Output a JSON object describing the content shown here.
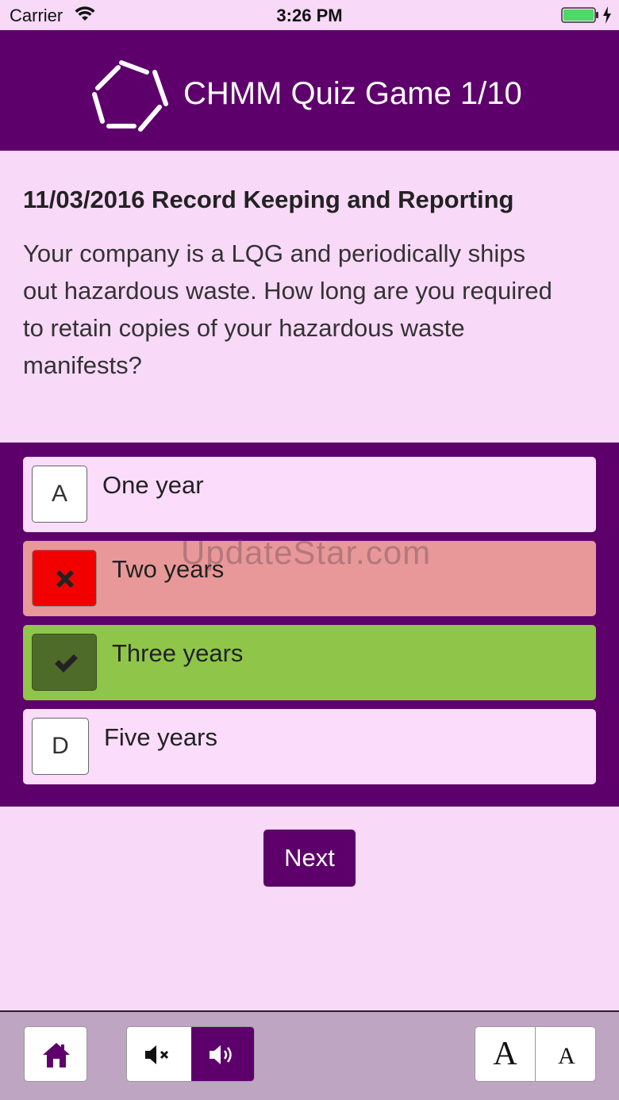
{
  "status_bar": {
    "carrier": "Carrier",
    "time": "3:26 PM",
    "wifi_icon": "wifi-icon",
    "battery_icon": "battery-charging-icon"
  },
  "header": {
    "title": "CHMM Quiz Game 1/10",
    "logo_icon": "hexagon-logo-icon",
    "background_color": "#5e006b"
  },
  "question": {
    "heading": "11/03/2016 Record Keeping and Reporting",
    "text": "Your company is a LQG and periodically ships\nout hazardous waste.  How long are you required\nto retain copies of your hazardous waste\nmanifests?"
  },
  "answers": [
    {
      "key": "A",
      "label": "One year",
      "state": "unanswered"
    },
    {
      "key": "",
      "label": "Two years",
      "state": "wrong",
      "icon": "cross-icon",
      "color": "#e89898"
    },
    {
      "key": "",
      "label": "Three years",
      "state": "correct",
      "icon": "check-icon",
      "color": "#8fc64a"
    },
    {
      "key": "D",
      "label": "Five years",
      "state": "unanswered"
    }
  ],
  "watermark": "UpdateStar.com",
  "next_button": {
    "label": "Next"
  },
  "toolbar": {
    "home_icon": "home-icon",
    "mute_icon": "speaker-mute-icon",
    "unmute_icon": "speaker-on-icon",
    "font_large_label": "A",
    "font_small_label": "A"
  }
}
